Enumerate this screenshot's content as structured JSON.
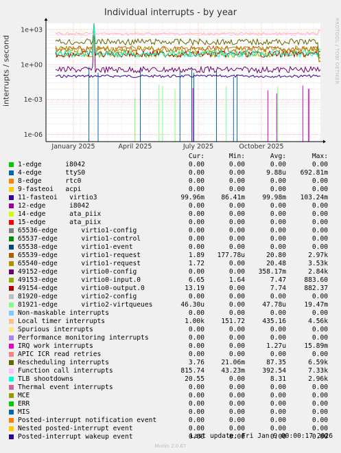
{
  "title": "Individual interrupts - by year",
  "side_label": "RRDTOOL / TOBI OETIKER",
  "footer": "Last update: Fri Jan  9 00:00:17 2026",
  "version": "Munin 2.0.67",
  "columns": {
    "cur": "Cur:",
    "min": "Min:",
    "avg": "Avg:",
    "max": "Max:"
  },
  "chart_data": {
    "type": "line",
    "ylabel": "interrupts / second",
    "yscale": "log",
    "y_ticks": [
      "1e-06",
      "1e-03",
      "1e+00",
      "1e+03"
    ],
    "x_ticks": [
      "January 2025",
      "April 2025",
      "July 2025",
      "October 2025"
    ],
    "grid": true,
    "series": [
      {
        "name": "1-edge      i8042",
        "color": "#00cc00",
        "cur": "0.00",
        "min": "0.00",
        "avg": "0.00",
        "max": "0.00"
      },
      {
        "name": "4-edge      ttyS0",
        "color": "#0066b3",
        "cur": "0.00",
        "min": "0.00",
        "avg": "9.88u",
        "max": "692.81m"
      },
      {
        "name": "8-edge      rtc0",
        "color": "#ff8000",
        "cur": "0.00",
        "min": "0.00",
        "avg": "0.00",
        "max": "0.00"
      },
      {
        "name": "9-fasteoi   acpi",
        "color": "#ffcc00",
        "cur": "0.00",
        "min": "0.00",
        "avg": "0.00",
        "max": "0.00"
      },
      {
        "name": "11-fasteoi   virtio3",
        "color": "#330099",
        "cur": "99.96m",
        "min": "86.41m",
        "avg": "99.98m",
        "max": "103.24m"
      },
      {
        "name": "12-edge      i8042",
        "color": "#990099",
        "cur": "0.00",
        "min": "0.00",
        "avg": "0.00",
        "max": "0.00"
      },
      {
        "name": "14-edge      ata_piix",
        "color": "#ccff00",
        "cur": "0.00",
        "min": "0.00",
        "avg": "0.00",
        "max": "0.00"
      },
      {
        "name": "15-edge      ata_piix",
        "color": "#ff0000",
        "cur": "0.00",
        "min": "0.00",
        "avg": "0.00",
        "max": "0.00"
      },
      {
        "name": "65536-edge      virtio1-config",
        "color": "#808080",
        "cur": "0.00",
        "min": "0.00",
        "avg": "0.00",
        "max": "0.00"
      },
      {
        "name": "65537-edge      virtio1-control",
        "color": "#008f00",
        "cur": "0.00",
        "min": "0.00",
        "avg": "0.00",
        "max": "0.00"
      },
      {
        "name": "65538-edge      virtio1-event",
        "color": "#00487d",
        "cur": "0.00",
        "min": "0.00",
        "avg": "0.00",
        "max": "0.00"
      },
      {
        "name": "65539-edge      virtio1-request",
        "color": "#b35a00",
        "cur": "1.89",
        "min": "177.78u",
        "avg": "20.80",
        "max": "2.97k"
      },
      {
        "name": "65540-edge      virtio1-request",
        "color": "#b38f00",
        "cur": "1.72",
        "min": "0.00",
        "avg": "20.48",
        "max": "3.53k"
      },
      {
        "name": "49152-edge      virtio0-config",
        "color": "#6b006b",
        "cur": "0.00",
        "min": "0.00",
        "avg": "358.17m",
        "max": "2.84k"
      },
      {
        "name": "49153-edge      virtio0-input.0",
        "color": "#8fb300",
        "cur": "6.65",
        "min": "1.64",
        "avg": "7.47",
        "max": "883.60"
      },
      {
        "name": "49154-edge      virtio0-output.0",
        "color": "#b30000",
        "cur": "13.19",
        "min": "0.00",
        "avg": "7.74",
        "max": "882.37"
      },
      {
        "name": "81920-edge      virtio2-config",
        "color": "#bebebe",
        "cur": "0.00",
        "min": "0.00",
        "avg": "0.00",
        "max": "0.00"
      },
      {
        "name": "81921-edge      virtio2-virtqueues",
        "color": "#80ff80",
        "cur": "46.30u",
        "min": "0.00",
        "avg": "47.78u",
        "max": "19.47m"
      },
      {
        "name": "Non-maskable interrupts",
        "color": "#80c9ff",
        "cur": "0.00",
        "min": "0.00",
        "avg": "0.00",
        "max": "0.00"
      },
      {
        "name": "Local timer interrupts",
        "color": "#ffc080",
        "cur": "1.00k",
        "min": "151.72",
        "avg": "435.16",
        "max": "4.56k"
      },
      {
        "name": "Spurious interrupts",
        "color": "#ffe680",
        "cur": "0.00",
        "min": "0.00",
        "avg": "0.00",
        "max": "0.00"
      },
      {
        "name": "Performance monitoring interrupts",
        "color": "#aa80ff",
        "cur": "0.00",
        "min": "0.00",
        "avg": "0.00",
        "max": "0.00"
      },
      {
        "name": "IRQ work interrupts",
        "color": "#ee00cc",
        "cur": "0.00",
        "min": "0.00",
        "avg": "1.27u",
        "max": "15.89m"
      },
      {
        "name": "APIC ICR read retries",
        "color": "#ff8080",
        "cur": "0.00",
        "min": "0.00",
        "avg": "0.00",
        "max": "0.00"
      },
      {
        "name": "Rescheduling interrupts",
        "color": "#666600",
        "cur": "3.76",
        "min": "21.06m",
        "avg": "87.35",
        "max": "6.59k"
      },
      {
        "name": "Function call interrupts",
        "color": "#ffbfff",
        "cur": "815.74",
        "min": "43.23m",
        "avg": "392.54",
        "max": "7.33k"
      },
      {
        "name": "TLB shootdowns",
        "color": "#00ffcc",
        "cur": "20.55",
        "min": "0.00",
        "avg": "8.31",
        "max": "2.96k"
      },
      {
        "name": "Thermal event interrupts",
        "color": "#cc6699",
        "cur": "0.00",
        "min": "0.00",
        "avg": "0.00",
        "max": "0.00"
      },
      {
        "name": "MCE",
        "color": "#999900",
        "cur": "0.00",
        "min": "0.00",
        "avg": "0.00",
        "max": "0.00"
      },
      {
        "name": "ERR",
        "color": "#00cc00",
        "cur": "0.00",
        "min": "0.00",
        "avg": "0.00",
        "max": "0.00"
      },
      {
        "name": "MIS",
        "color": "#0066b3",
        "cur": "0.00",
        "min": "0.00",
        "avg": "0.00",
        "max": "0.00"
      },
      {
        "name": "Posted-interrupt notification event",
        "color": "#ff8000",
        "cur": "0.00",
        "min": "0.00",
        "avg": "0.00",
        "max": "0.00"
      },
      {
        "name": "Nested posted-interrupt event",
        "color": "#ffcc00",
        "cur": "0.00",
        "min": "0.00",
        "avg": "0.00",
        "max": "0.00"
      },
      {
        "name": "Posted-interrupt wakeup event",
        "color": "#330099",
        "cur": "0.00",
        "min": "0.00",
        "avg": "0.00",
        "max": "0.00"
      }
    ]
  }
}
